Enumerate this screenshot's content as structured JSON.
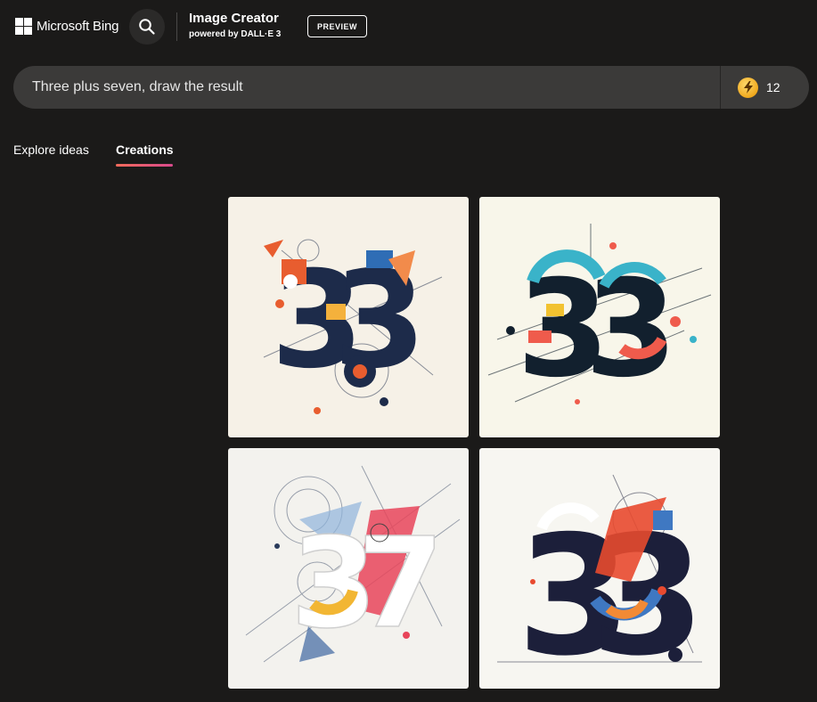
{
  "header": {
    "brand": "Microsoft Bing",
    "title": "Image Creator",
    "subtitle": "powered by DALL·E 3",
    "badge": "PREVIEW"
  },
  "prompt": {
    "value": "Three plus seven, draw the result",
    "boosts": "12"
  },
  "tabs": [
    {
      "label": "Explore ideas",
      "active": false
    },
    {
      "label": "Creations",
      "active": true
    }
  ],
  "colors": {
    "background": "#1b1a19",
    "prompt_bar": "#3b3a39",
    "tab_accent_start": "#f36b5b",
    "tab_accent_end": "#d94a8c",
    "boost_coin": "#f0a91e"
  },
  "icons": {
    "search": "search-icon",
    "boost": "lightning-icon",
    "logo": "microsoft-logo-icon"
  },
  "images": [
    {
      "depicts": "33"
    },
    {
      "depicts": "33"
    },
    {
      "depicts": "37"
    },
    {
      "depicts": "33"
    }
  ]
}
